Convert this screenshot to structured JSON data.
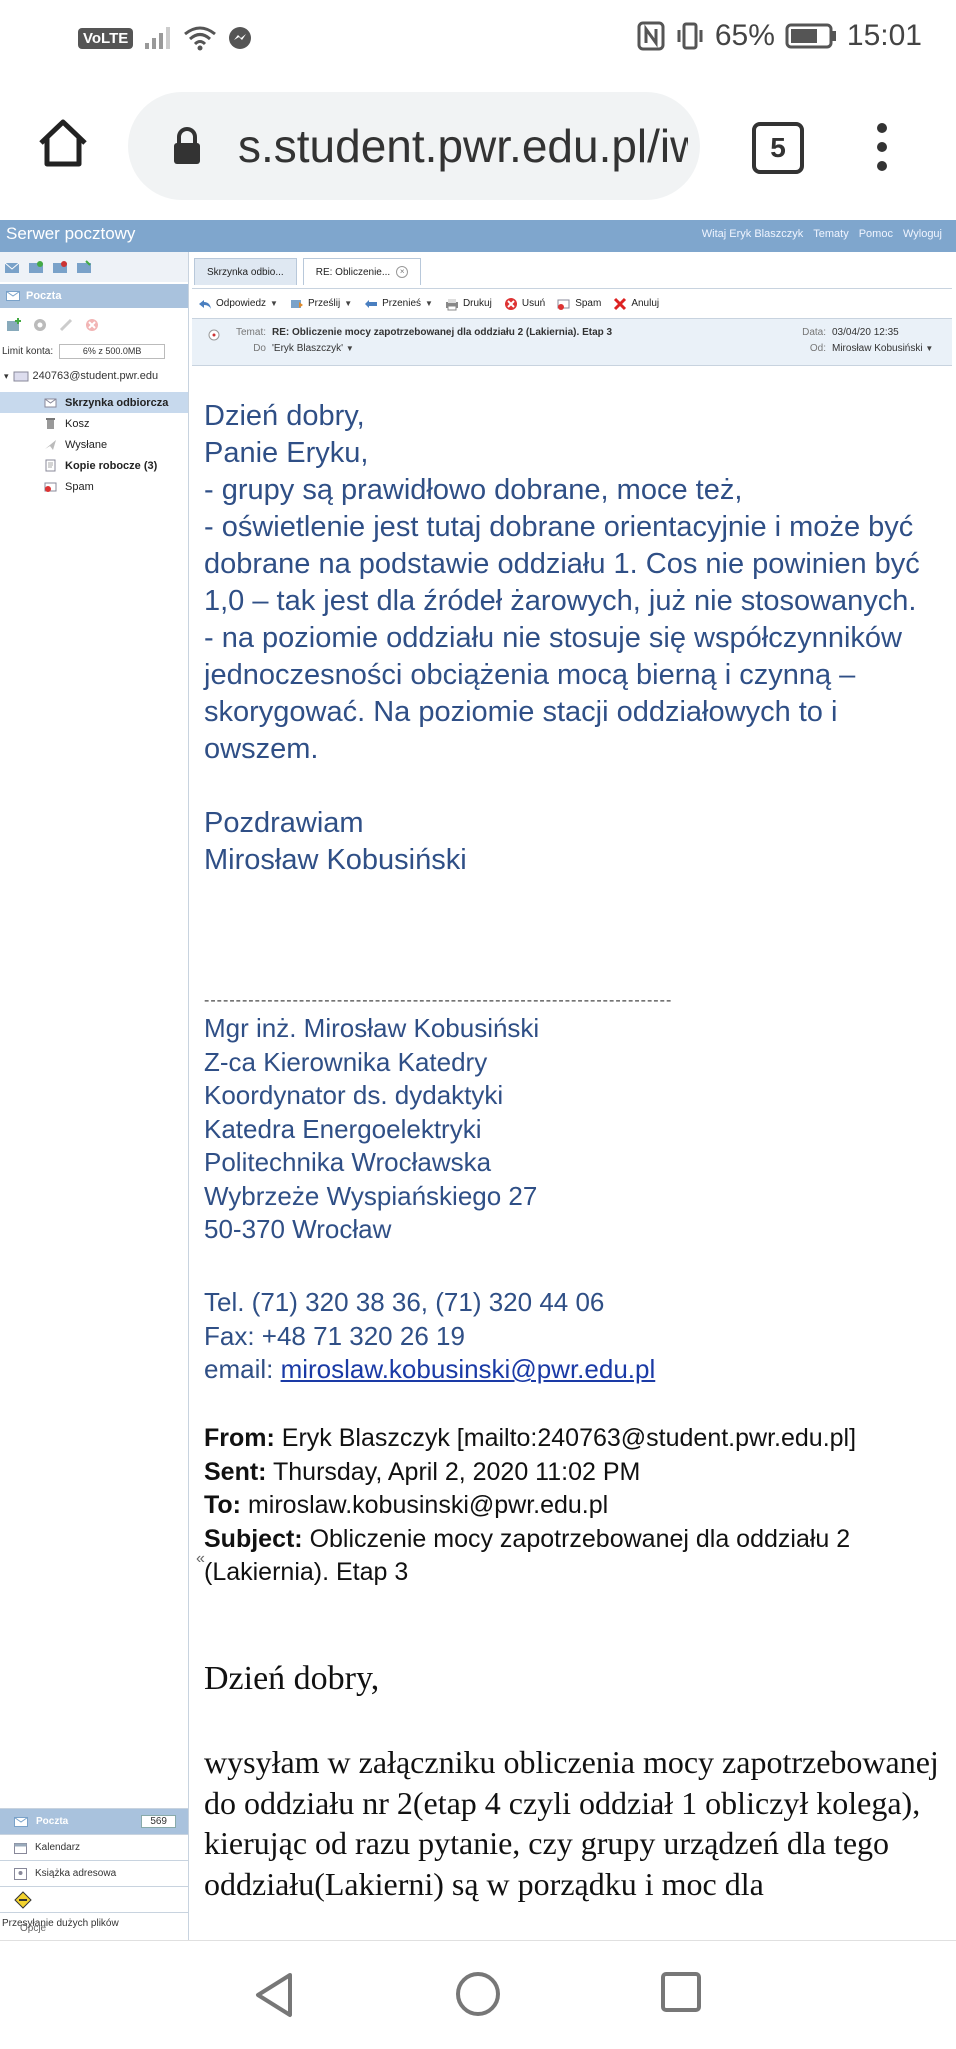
{
  "status_bar": {
    "volte": "VoLTE",
    "battery": "65%",
    "time": "15:01"
  },
  "browser": {
    "url": "s.student.pwr.edu.pl/iw",
    "tab_count": "5"
  },
  "webmail_header": {
    "title": "Serwer pocztowy",
    "links": [
      "Witaj Eryk Blaszczyk",
      "Tematy",
      "Pomoc",
      "Wyloguj"
    ]
  },
  "sidebar": {
    "section": "Poczta",
    "quota_label": "Limit konta:",
    "quota_value": "6% z 500.0MB",
    "account": "240763@student.pwr.edu",
    "folders": [
      {
        "label": "Skrzynka odbiorcza"
      },
      {
        "label": "Kosz"
      },
      {
        "label": "Wysłane"
      },
      {
        "label": "Kopie robocze (3)"
      },
      {
        "label": "Spam"
      }
    ],
    "bottom": {
      "poczta": "Poczta",
      "poczta_count": "569",
      "kalendarz": "Kalendarz",
      "ksiazka": "Książka adresowa",
      "przesylanie": "Przesyłanie dużych plików",
      "opcje": "Opcje"
    }
  },
  "tabs": [
    {
      "label": "Skrzynka odbio..."
    },
    {
      "label": "RE: Obliczenie..."
    }
  ],
  "toolbar": {
    "reply": "Odpowiedz",
    "forward": "Prześlij",
    "move": "Przenieś",
    "print": "Drukuj",
    "delete": "Usuń",
    "spam": "Spam",
    "cancel": "Anuluj"
  },
  "message_header": {
    "subject_label": "Temat:",
    "subject": "RE: Obliczenie mocy zapotrzebowanej dla oddziału 2 (Lakiernia). Etap 3",
    "to_label": "Do",
    "to": "'Eryk Blaszczyk'",
    "date_label": "Data:",
    "date": "03/04/20 12:35",
    "from_label": "Od:",
    "from": "Mirosław Kobusiński"
  },
  "body": {
    "greeting_lines": [
      "Dzień dobry,",
      "Panie Eryku,",
      "- grupy są prawidłowo dobrane, moce też,",
      "- oświetlenie jest tutaj dobrane orientacyjnie i może być dobrane na podstawie oddziału 1. Cos nie powinien być 1,0 – tak jest dla źródeł żarowych, już nie stosowanych.",
      "- na poziomie oddziału nie stosuje się współczynników jednoczesności obciążenia mocą bierną i czynną – skorygować. Na poziomie stacji oddziałowych to i owszem."
    ],
    "regards": "Pozdrawiam",
    "regards_name": "Mirosław Kobusiński",
    "separator": "--------------------------------------------------------------------------",
    "signature": [
      "Mgr inż. Mirosław Kobusiński",
      "Z-ca Kierownika Katedry",
      "Koordynator ds. dydaktyki",
      "Katedra Energoelektryki",
      "Politechnika Wrocławska",
      "Wybrzeże Wyspiańskiego 27",
      "50-370 Wrocław"
    ],
    "tel": "Tel. (71) 320 38 36, (71) 320 44 06",
    "fax": "Fax: +48 71 320 26 19",
    "email_label": "email: ",
    "email": "miroslaw.kobusinski@pwr.edu.pl",
    "quoted": {
      "from_label": "From:",
      "from": " Eryk Blaszczyk [mailto:240763@student.pwr.edu.pl]",
      "sent_label": "Sent:",
      "sent": " Thursday, April 2, 2020 11:02 PM",
      "to_label": "To:",
      "to": " miroslaw.kobusinski@pwr.edu.pl",
      "subject_label": "Subject:",
      "subject": " Obliczenie mocy zapotrzebowanej dla oddziału 2 (Lakiernia). Etap 3",
      "greeting": "Dzień dobry,",
      "paragraph": "wysyłam w załączniku obliczenia mocy zapotrzebowanej do oddziału nr 2(etap 4 czyli oddział 1 obliczył kolega), kierując od razu pytanie, czy grupy urządzeń dla tego oddziału(Lakierni) są w porządku i moc dla"
    }
  },
  "collapse_glyph": "«"
}
